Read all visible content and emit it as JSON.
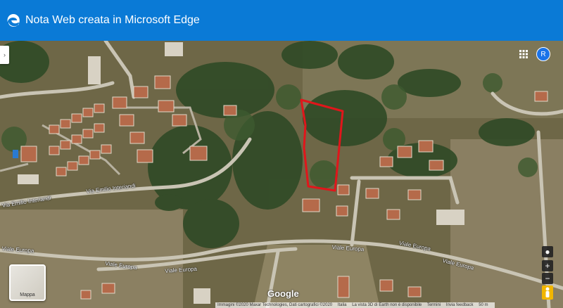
{
  "window": {
    "title": "Nota Web creata in Microsoft Edge"
  },
  "map": {
    "streets": [
      {
        "name": "Via Emilio Interiandi"
      },
      {
        "name": "Via Emilio Interiandi"
      },
      {
        "name": "Viale Europa"
      },
      {
        "name": "Viale Europa"
      },
      {
        "name": "Viale Europa"
      },
      {
        "name": "Viale Europa"
      },
      {
        "name": "Viale Europa"
      },
      {
        "name": "Viale Europa"
      }
    ],
    "layer_toggle_label": "Mappa",
    "google_logo": "Google",
    "user_initial": "R",
    "attribution": [
      "Immagini ©2020 Maxar Technologies, Dati cartografici ©2020",
      "Italia",
      "La vista 3D di Earth non è disponibile",
      "Termini",
      "Invia feedback",
      "50 m"
    ],
    "annotation_color": "#e0161b"
  }
}
